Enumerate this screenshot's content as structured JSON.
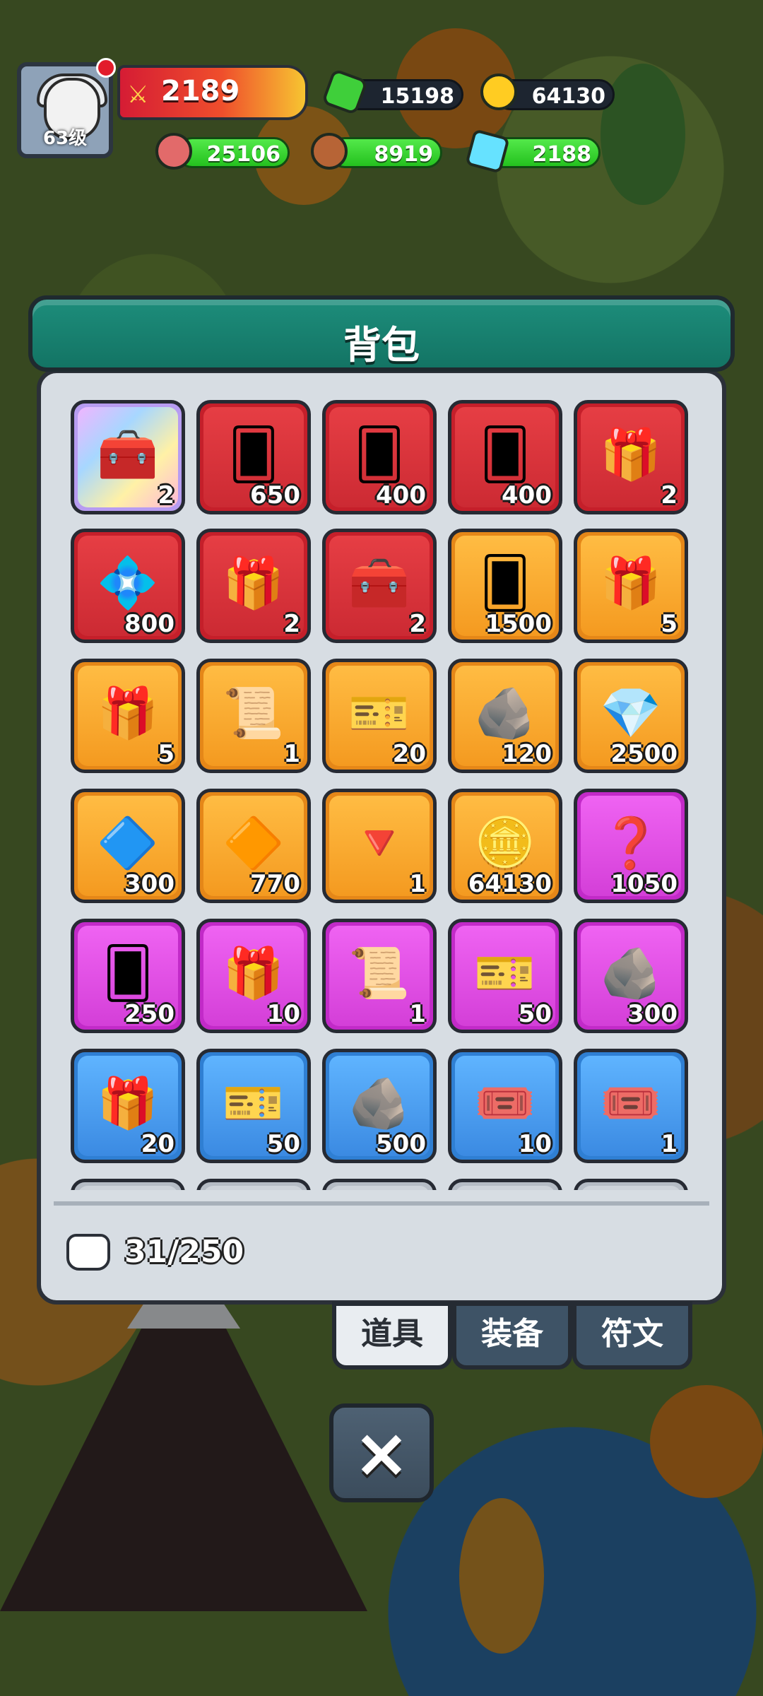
{
  "hud": {
    "level": "63级",
    "power": "2189",
    "resources": {
      "gems": "15198",
      "gold": "64130",
      "meat": "25106",
      "wood": "8919",
      "crystal": "2188"
    }
  },
  "panel": {
    "title": "背包",
    "capacity": "31/250"
  },
  "items": [
    {
      "name": "purple-chest",
      "rarity": "rainbow",
      "icon": "🧰",
      "qty": "2"
    },
    {
      "name": "hero-card-red",
      "rarity": "red",
      "icon": "🂠",
      "qty": "650"
    },
    {
      "name": "pattern-card-red",
      "rarity": "red",
      "icon": "🂠",
      "qty": "400"
    },
    {
      "name": "sanguo-card",
      "rarity": "red",
      "icon": "🂠",
      "qty": "400"
    },
    {
      "name": "mystery-chest-red",
      "rarity": "red",
      "icon": "🎁",
      "qty": "2"
    },
    {
      "name": "blue-crown-chest",
      "rarity": "red",
      "icon": "💠",
      "qty": "800"
    },
    {
      "name": "mystery-chest-red-2",
      "rarity": "red",
      "icon": "🎁",
      "qty": "2"
    },
    {
      "name": "purple-star-chest",
      "rarity": "red",
      "icon": "🧰",
      "qty": "2"
    },
    {
      "name": "hero-card-orange",
      "rarity": "orange",
      "icon": "🂠",
      "qty": "1500"
    },
    {
      "name": "mystery-chest-orange",
      "rarity": "orange",
      "icon": "🎁",
      "qty": "5"
    },
    {
      "name": "mystery-chest-purple-orange",
      "rarity": "orange",
      "icon": "🎁",
      "qty": "5"
    },
    {
      "name": "shield-scroll",
      "rarity": "orange",
      "icon": "📜",
      "qty": "1"
    },
    {
      "name": "red-ticket",
      "rarity": "orange",
      "icon": "🎫",
      "qty": "20"
    },
    {
      "name": "swirl-stone-purple",
      "rarity": "orange",
      "icon": "🪨",
      "qty": "120"
    },
    {
      "name": "pink-gem",
      "rarity": "orange",
      "icon": "💎",
      "qty": "2500"
    },
    {
      "name": "blue-gem",
      "rarity": "orange",
      "icon": "🔷",
      "qty": "300"
    },
    {
      "name": "gold-crystal",
      "rarity": "orange",
      "icon": "🔶",
      "qty": "770"
    },
    {
      "name": "red-crystal",
      "rarity": "orange",
      "icon": "🔻",
      "qty": "1"
    },
    {
      "name": "gold-coin",
      "rarity": "orange",
      "icon": "🪙",
      "qty": "64130"
    },
    {
      "name": "mystery-card-purple",
      "rarity": "purple",
      "icon": "❓",
      "qty": "1050"
    },
    {
      "name": "hero-card-purple",
      "rarity": "purple",
      "icon": "🂠",
      "qty": "250"
    },
    {
      "name": "mystery-chest-purple",
      "rarity": "purple",
      "icon": "🎁",
      "qty": "10"
    },
    {
      "name": "shield-scroll-purple",
      "rarity": "purple",
      "icon": "📜",
      "qty": "1"
    },
    {
      "name": "orange-ticket",
      "rarity": "purple",
      "icon": "🎫",
      "qty": "50"
    },
    {
      "name": "swirl-stone-green",
      "rarity": "purple",
      "icon": "🪨",
      "qty": "300"
    },
    {
      "name": "mystery-chest-blue",
      "rarity": "blue",
      "icon": "🎁",
      "qty": "20"
    },
    {
      "name": "blue-ticket",
      "rarity": "blue",
      "icon": "🎫",
      "qty": "50"
    },
    {
      "name": "swirl-stone-blue",
      "rarity": "blue",
      "icon": "🪨",
      "qty": "500"
    },
    {
      "name": "red-text-ticket",
      "rarity": "blue",
      "icon": "🎟️",
      "qty": "10"
    },
    {
      "name": "rename-ticket",
      "rarity": "blue",
      "icon": "🎟️",
      "qty": "1"
    },
    {
      "name": "partial-slot-1",
      "rarity": "gray",
      "icon": "",
      "qty": ""
    },
    {
      "name": "partial-slot-2",
      "rarity": "gray",
      "icon": "",
      "qty": ""
    },
    {
      "name": "partial-slot-3",
      "rarity": "gray",
      "icon": "",
      "qty": ""
    },
    {
      "name": "partial-slot-4",
      "rarity": "gray",
      "icon": "",
      "qty": ""
    },
    {
      "name": "partial-slot-5",
      "rarity": "gray",
      "icon": "",
      "qty": ""
    }
  ],
  "tabs": [
    {
      "label": "道具",
      "active": true
    },
    {
      "label": "装备",
      "active": false
    },
    {
      "label": "符文",
      "active": false
    }
  ],
  "close": "×"
}
